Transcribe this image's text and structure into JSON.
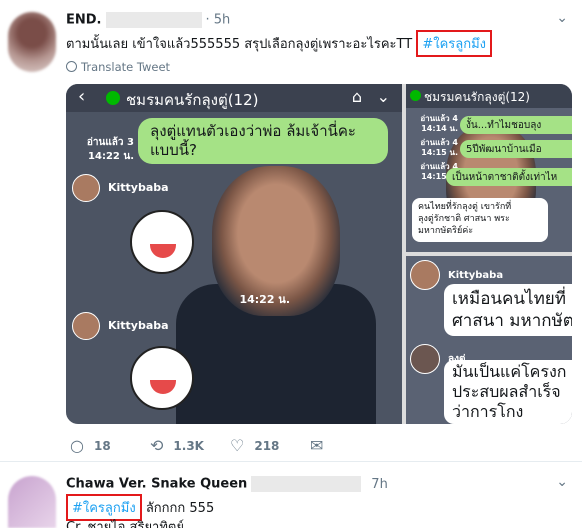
{
  "tweet1": {
    "name": "END.",
    "time": "· 5h",
    "text_before": "ตามนั้นเลย เข้าใจแล้ว555555 สรุปเลือกลุงตู่เพราะอะไรคะTT",
    "hashtag": "#ใครลูกมึง",
    "translate_label": "Translate Tweet",
    "actions": {
      "replies": "18",
      "retweets": "1.3K",
      "likes": "218"
    },
    "media": {
      "main": {
        "title": "ชมรมคนรักลุงตู่(12)",
        "read_label": "อ่านแล้ว 3",
        "read_time": "14:22 น.",
        "bubble_text_1": "ลุงตู่แทนตัวเองว่าพ่อ ล้มเจ้านี่คะ",
        "bubble_text_2": "แบบนี้?",
        "user1": "Kittybaba",
        "photo_time": "14:22 น.",
        "user2": "Kittybaba"
      },
      "top_right": {
        "title": "ชมรมคนรักลุงตู่(12)",
        "r1_label": "อ่านแล้ว 4",
        "r1_time": "14:14 น.",
        "m1": "งั้น...ทำไมชอบลุง",
        "r2_label": "อ่านแล้ว 4",
        "r2_time": "14:15 น.",
        "m2": "5ปีพัฒนาบ้านเมือ",
        "r3_label": "อ่านแล้ว 4",
        "r3_time": "14:15 น.",
        "m3": "เป็นหน้าตาชาติตั้งเท่าไห",
        "m4_line1": "คนไทยที่รักลุงตู่ เขารักที่",
        "m4_line2": "ลุงตู่รักชาติ ศาสนา พระ",
        "m4_line3": "มหากษัตริย์ค่ะ"
      },
      "bottom_right": {
        "user1": "Kittybaba",
        "line1": "เหมือนคนไทยที่",
        "line2": "ศาสนา มหากษัต",
        "user2": "ลุงตู่",
        "line3": "มันเป็นแค่โครงก",
        "line4": "ประสบผลสำเร็จ",
        "line5": "ว่าการโกง"
      }
    }
  },
  "tweet2": {
    "name": "Chawa Ver. Snake Queen",
    "time": "7h",
    "hashtag": "#ใครลูกมึง",
    "text_after": "ลักกกก 555",
    "line2": "Cr. ชายไจ สุริยาทิตย์"
  },
  "colors": {
    "link": "#1da1f2",
    "highlight": "#e3191b",
    "line_green": "#a5e286",
    "muted": "#657786"
  },
  "icons": [
    "chevron-down-icon",
    "globe-icon",
    "reply-icon",
    "retweet-icon",
    "like-icon",
    "message-icon",
    "back-arrow-icon",
    "home-icon"
  ]
}
